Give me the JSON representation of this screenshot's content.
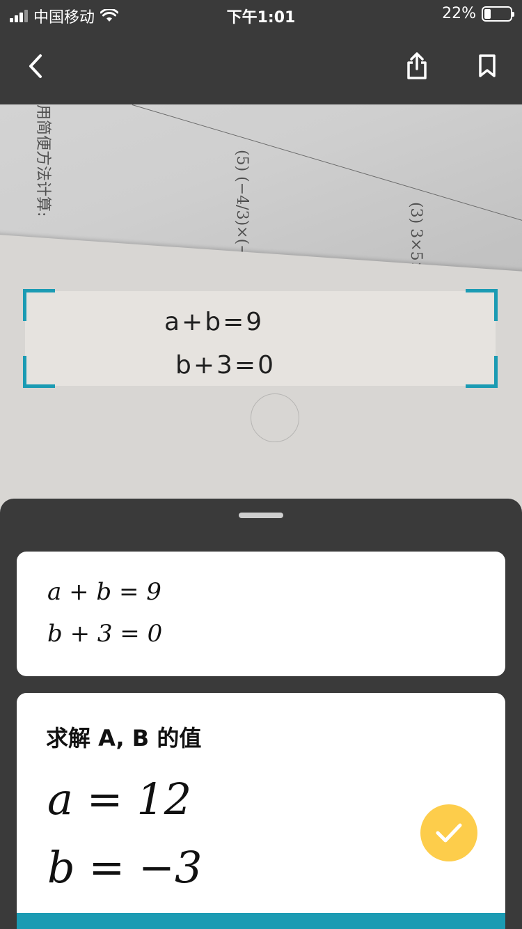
{
  "status_bar": {
    "carrier": "中国移动",
    "time": "下午1:01",
    "battery": "22%"
  },
  "nav": {
    "back_icon": "chevron-left-icon",
    "share_icon": "share-icon",
    "bookmark_icon": "bookmark-icon"
  },
  "photo": {
    "handwriting_line1": "a+b=9",
    "handwriting_line2": "b+3=0"
  },
  "recognized": {
    "line1": "a + b = 9",
    "line2": "b + 3 = 0"
  },
  "solution": {
    "title": "求解 A, B 的值",
    "result1": "a = 12",
    "result2": "b = −3",
    "confirm_icon": "checkmark-icon"
  },
  "colors": {
    "accent": "#1b9bb3",
    "confirm": "#fdcd4b",
    "chrome": "#3a3a3a"
  }
}
